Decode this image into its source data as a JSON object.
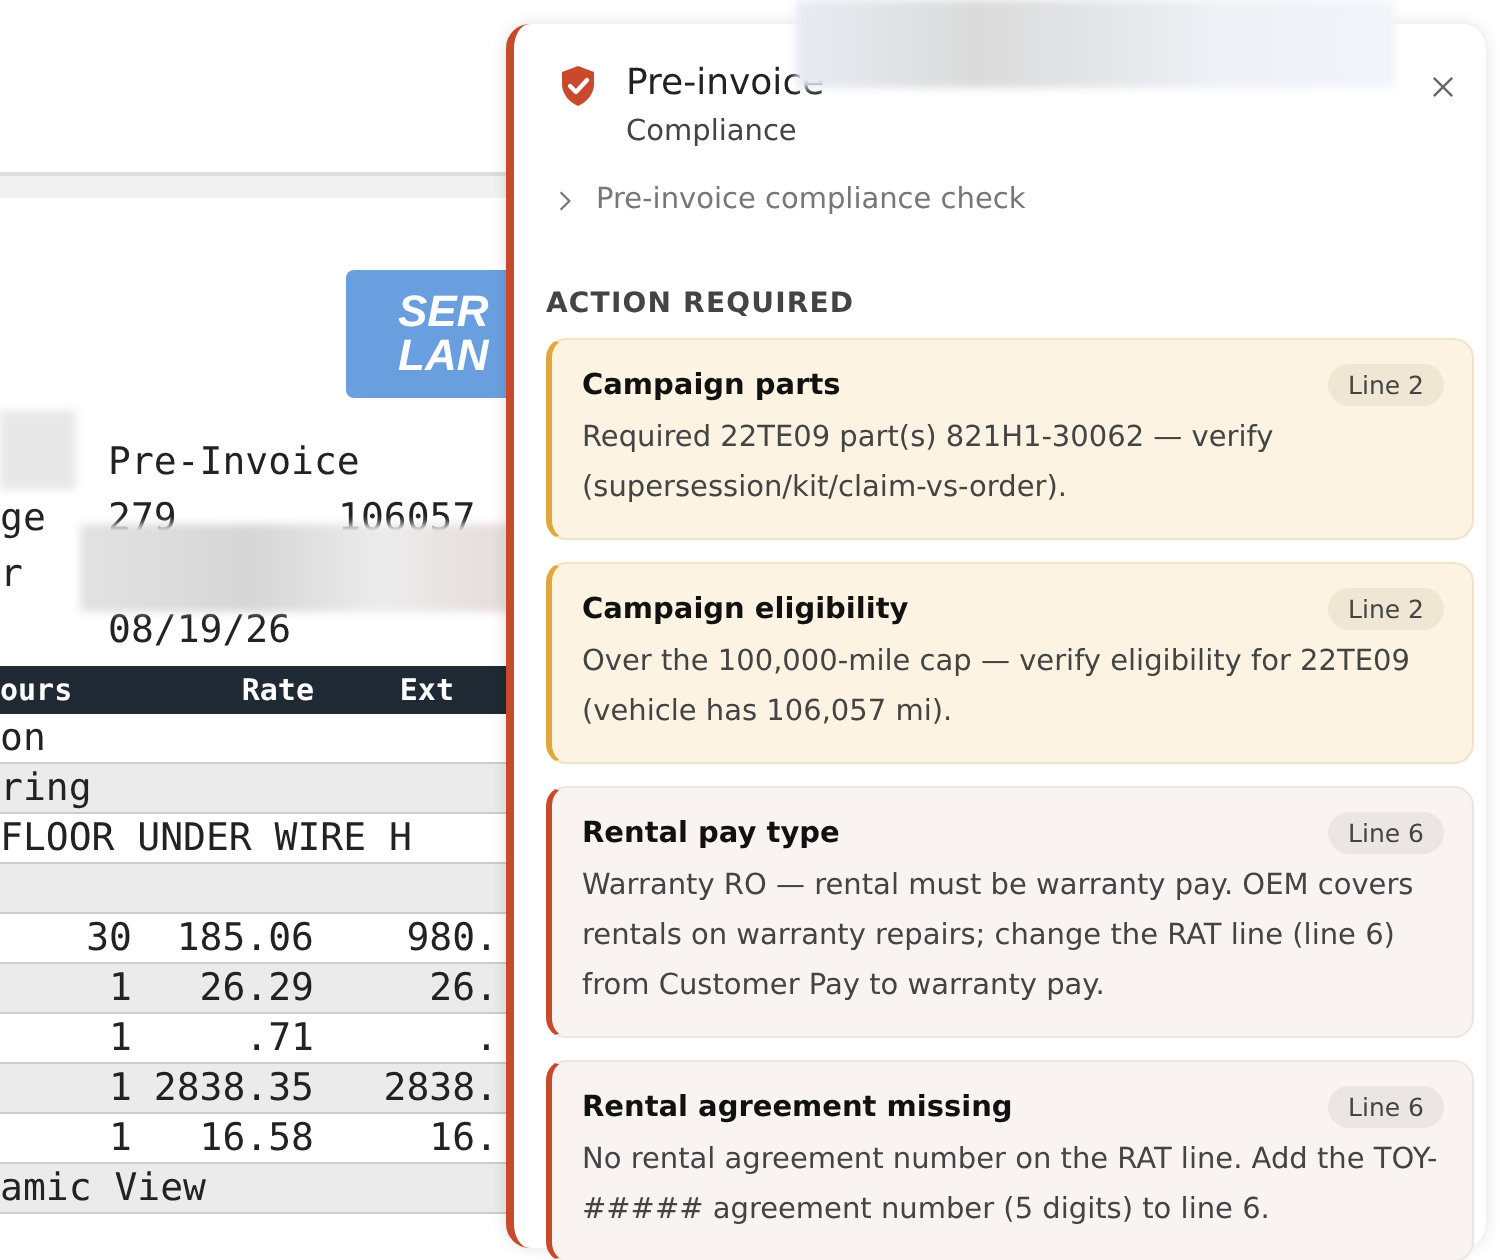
{
  "document": {
    "logo": [
      "SER",
      "LAN"
    ],
    "header_lines": [
      {
        "col_a": "Pre-Invoice"
      },
      {
        "label": "ge",
        "col_a": "279",
        "col_b": "106057"
      },
      {
        "label": "r"
      },
      {
        "col_a": "08/19/26"
      }
    ],
    "table": {
      "columns": [
        "ours",
        "Rate",
        "Ext"
      ],
      "rows": [
        {
          "kind": "text",
          "text": "on"
        },
        {
          "kind": "text",
          "text": "ring"
        },
        {
          "kind": "text",
          "text": "FLOOR UNDER WIRE H"
        },
        {
          "kind": "blank"
        },
        {
          "kind": "nums",
          "cells": [
            "30",
            "185.06",
            "980."
          ]
        },
        {
          "kind": "nums",
          "cells": [
            "1",
            "26.29",
            "26."
          ]
        },
        {
          "kind": "nums",
          "cells": [
            "1",
            ".71",
            "."
          ]
        },
        {
          "kind": "nums",
          "cells": [
            "1",
            "2838.35",
            "2838."
          ]
        },
        {
          "kind": "nums",
          "cells": [
            "1",
            "16.58",
            "16."
          ]
        },
        {
          "kind": "text",
          "text": "amic View"
        }
      ]
    }
  },
  "panel": {
    "title": "Pre-invoice",
    "subtitle": "Compliance",
    "expander": {
      "label": "Pre-invoice compliance check",
      "expanded": false
    },
    "section": "ACTION REQUIRED",
    "cards": [
      {
        "kind": "warning",
        "title": "Campaign parts",
        "badge": "Line 2",
        "text": "Required 22TE09 part(s) 821H1-30062 — verify (supersession/kit/claim-vs-order)."
      },
      {
        "kind": "warning",
        "title": "Campaign eligibility",
        "badge": "Line 2",
        "text": "Over the 100,000-mile cap — verify eligibility for 22TE09 (vehicle has 106,057 mi)."
      },
      {
        "kind": "error",
        "title": "Rental pay type",
        "badge": "Line 6",
        "text": "Warranty RO — rental must be warranty pay. OEM covers rentals on warranty repairs; change the RAT line (line 6) from Customer Pay to warranty pay."
      },
      {
        "kind": "error",
        "title": "Rental agreement missing",
        "badge": "Line 6",
        "text": "No rental agreement number on the RAT line. Add the TOY-##### agreement number (5 digits) to line 6."
      }
    ]
  }
}
